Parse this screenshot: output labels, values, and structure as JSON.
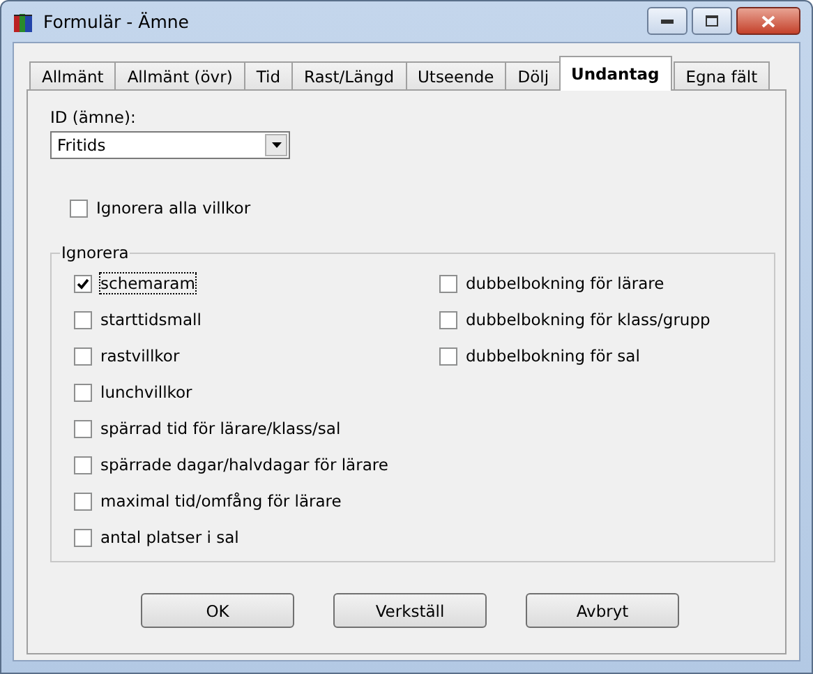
{
  "window": {
    "title": "Formulär - Ämne"
  },
  "tabs": [
    {
      "label": "Allmänt",
      "selected": false
    },
    {
      "label": "Allmänt (övr)",
      "selected": false
    },
    {
      "label": "Tid",
      "selected": false
    },
    {
      "label": "Rast/Längd",
      "selected": false
    },
    {
      "label": "Utseende",
      "selected": false
    },
    {
      "label": "Dölj",
      "selected": false
    },
    {
      "label": "Undantag",
      "selected": true
    },
    {
      "label": "Egna fält",
      "selected": false
    }
  ],
  "id_field": {
    "label": "ID (ämne):",
    "value": "Fritids"
  },
  "ignore_all": {
    "label": "Ignorera alla villkor",
    "checked": false
  },
  "group": {
    "title": "Ignorera",
    "left": [
      {
        "label": "schemaram",
        "checked": true,
        "focused": true
      },
      {
        "label": "starttidsmall",
        "checked": false,
        "focused": false
      },
      {
        "label": "rastvillkor",
        "checked": false,
        "focused": false
      },
      {
        "label": "lunchvillkor",
        "checked": false,
        "focused": false
      },
      {
        "label": "spärrad tid för lärare/klass/sal",
        "checked": false,
        "focused": false
      },
      {
        "label": "spärrade dagar/halvdagar för lärare",
        "checked": false,
        "focused": false
      },
      {
        "label": "maximal tid/omfång för lärare",
        "checked": false,
        "focused": false
      },
      {
        "label": "antal platser i sal",
        "checked": false,
        "focused": false
      }
    ],
    "right": [
      {
        "label": "dubbelbokning för lärare",
        "checked": false,
        "focused": false
      },
      {
        "label": "dubbelbokning för klass/grupp",
        "checked": false,
        "focused": false
      },
      {
        "label": "dubbelbokning för sal",
        "checked": false,
        "focused": false
      }
    ]
  },
  "buttons": [
    "OK",
    "Verkställ",
    "Avbryt"
  ]
}
